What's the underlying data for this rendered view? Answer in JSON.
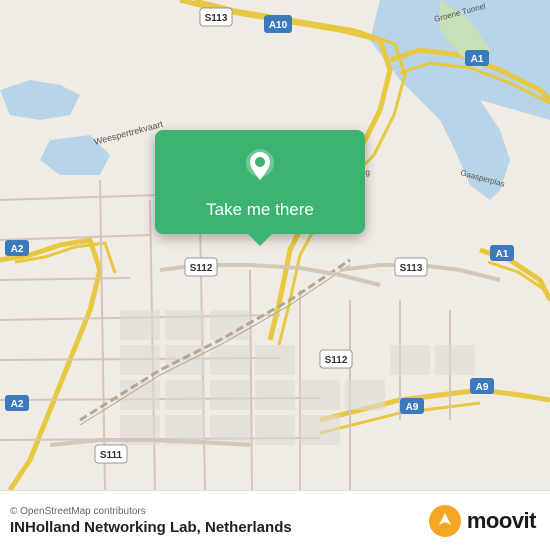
{
  "map": {
    "background_color": "#e8e0d8",
    "copyright": "© OpenStreetMap contributors",
    "attribution": "© OpenStreetMap contributors"
  },
  "popup": {
    "label": "Take me there",
    "pin_color": "#ffffff",
    "bg_color": "#3cb371"
  },
  "bottom_bar": {
    "copyright": "© OpenStreetMap contributors",
    "location_name": "INHolland Networking Lab, Netherlands",
    "moovit_label": "moovit"
  },
  "route_labels": {
    "a10": "A10",
    "a1": "A1",
    "a2_top": "A2",
    "a2_bottom": "A2",
    "a9": "A9",
    "s111": "S111",
    "s112_left": "S112",
    "s112_right": "S112",
    "s113_left": "S113",
    "s113_right": "S113"
  }
}
